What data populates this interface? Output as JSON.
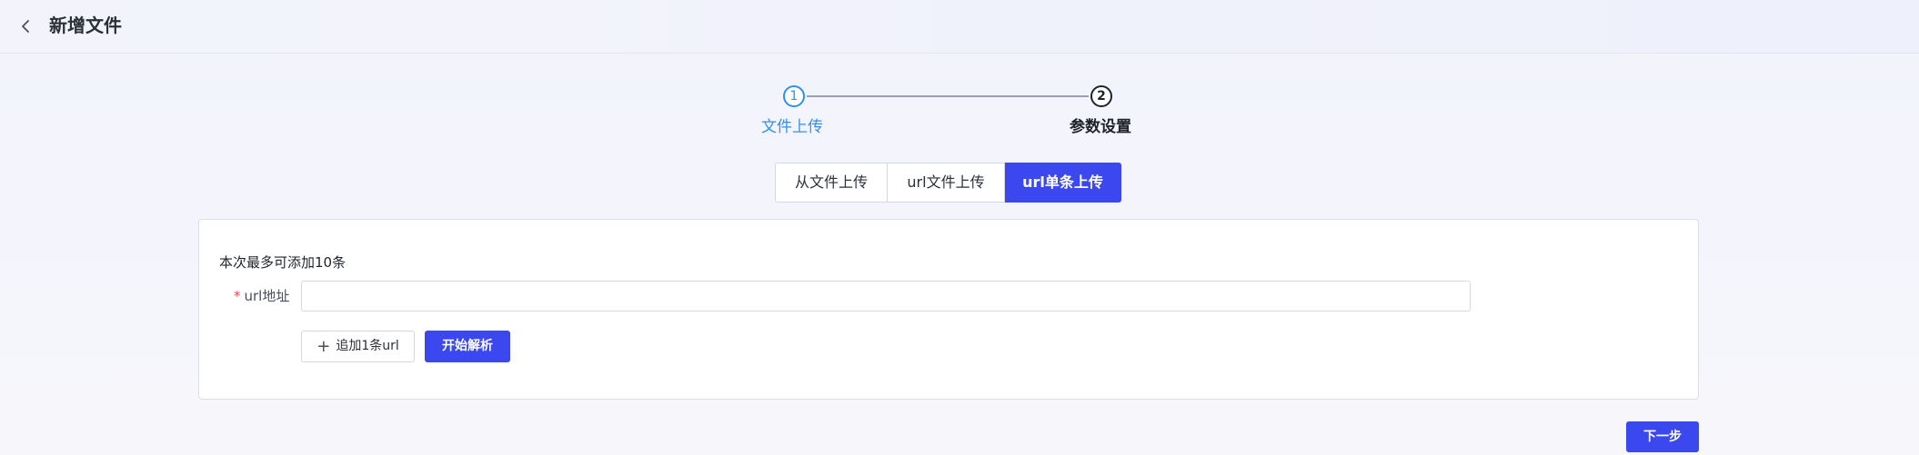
{
  "header": {
    "title": "新增文件",
    "back_icon": "chevron-left-icon"
  },
  "steps": [
    {
      "number": "1",
      "label": "文件上传",
      "state": "active",
      "color": "#2f8ff1"
    },
    {
      "number": "2",
      "label": "参数设置",
      "state": "pending",
      "color": "#1f2329"
    }
  ],
  "tabs": [
    {
      "label": "从文件上传",
      "selected": false
    },
    {
      "label": "url文件上传",
      "selected": false
    },
    {
      "label": "url单条上传",
      "selected": true
    }
  ],
  "form": {
    "limit_text": "本次最多可添加10条",
    "required_mark": "*",
    "url_label": "url地址",
    "url_value": "",
    "url_placeholder": "",
    "add_button_label": "追加1条url",
    "add_icon": "plus-icon",
    "parse_button_label": "开始解析"
  },
  "footer": {
    "next_button_label": "下一步"
  },
  "colors": {
    "primary": "#3b48f0",
    "step_active": "#2f8ff1",
    "required": "#e5484d"
  }
}
